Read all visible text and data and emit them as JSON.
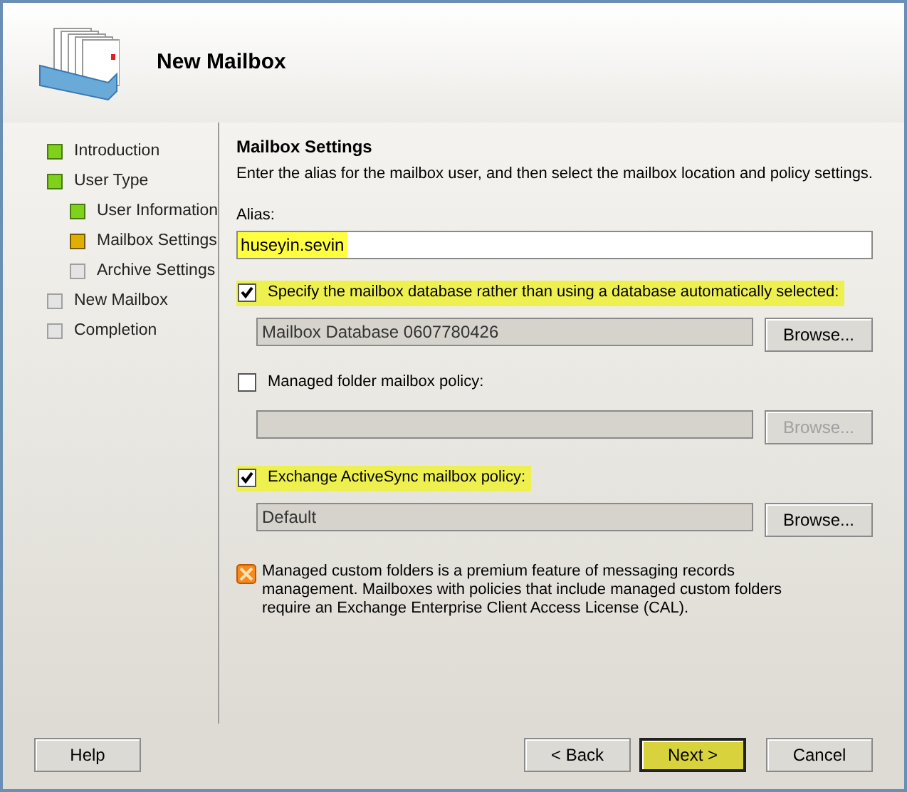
{
  "header": {
    "title": "New Mailbox"
  },
  "steps": [
    {
      "label": "Introduction",
      "completed": true,
      "current": false
    },
    {
      "label": "User Type",
      "completed": true,
      "current": false,
      "children": [
        {
          "label": "User Information",
          "completed": true,
          "current": false
        },
        {
          "label": "Mailbox Settings",
          "completed": false,
          "current": true
        },
        {
          "label": "Archive Settings",
          "completed": false,
          "current": false
        }
      ]
    },
    {
      "label": "New Mailbox",
      "completed": false,
      "current": false
    },
    {
      "label": "Completion",
      "completed": false,
      "current": false
    }
  ],
  "page": {
    "title": "Mailbox Settings",
    "description": "Enter the alias for the mailbox user, and then select the mailbox location and policy settings.",
    "alias": {
      "label": "Alias:",
      "value": "huseyin.sevin",
      "highlighted": true
    },
    "options": [
      {
        "label": "Specify the mailbox database rather than using a database automatically selected:",
        "checked": true,
        "highlighted": true,
        "value": "Mailbox Database 0607780426",
        "button": "Browse...",
        "disabled": false
      },
      {
        "label": "Managed folder mailbox policy:",
        "checked": false,
        "highlighted": false,
        "button": "Browse...",
        "disabled": true
      },
      {
        "label": "Exchange ActiveSync mailbox policy:",
        "checked": true,
        "highlighted": true,
        "value": "Default",
        "button": "Browse...",
        "disabled": false
      }
    ],
    "note": "Managed custom folders is a premium feature of messaging records management. Mailboxes with policies that include managed custom folders require an Exchange Enterprise Client Access License (CAL)."
  },
  "buttons": {
    "help": "Help",
    "back": "< Back",
    "next": {
      "label": "Next >",
      "highlighted": true
    },
    "cancel": "Cancel"
  }
}
